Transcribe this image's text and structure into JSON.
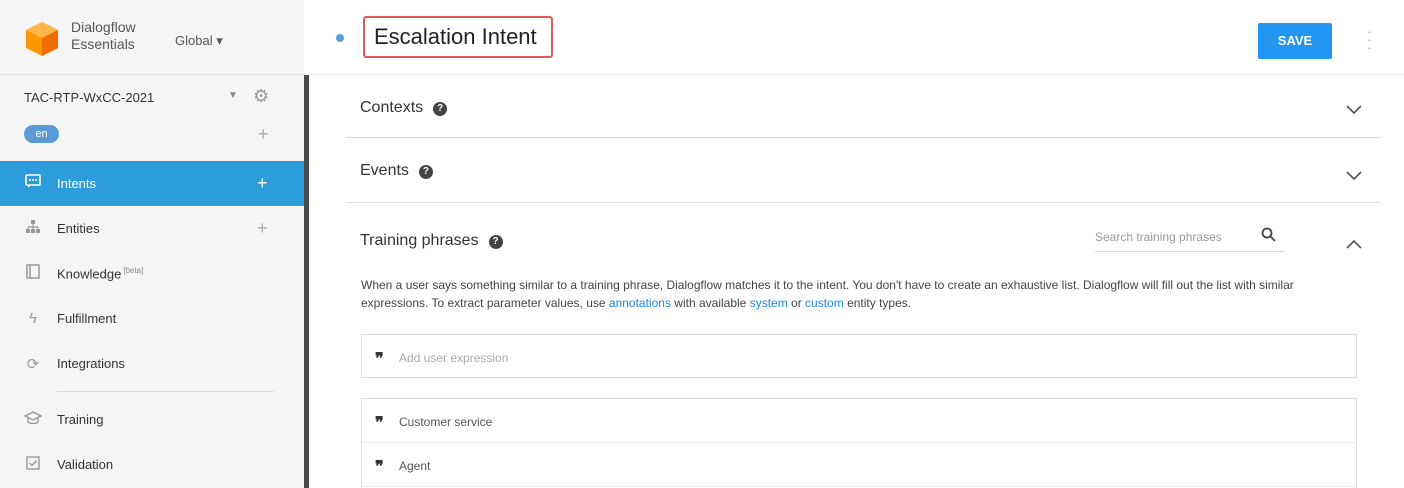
{
  "sidebar": {
    "brand_line1": "Dialogflow",
    "brand_line2": "Essentials",
    "region": "Global",
    "agent_name": "TAC-RTP-WxCC-2021",
    "language": "en",
    "nav": [
      {
        "label": "Intents",
        "icon": "chat-icon",
        "active": true
      },
      {
        "label": "Entities",
        "icon": "hierarchy-icon"
      },
      {
        "label": "Knowledge",
        "beta": "[beta]",
        "icon": "book-icon"
      },
      {
        "label": "Fulfillment",
        "icon": "bolt-icon"
      },
      {
        "label": "Integrations",
        "icon": "sync-icon"
      },
      {
        "label": "Training",
        "icon": "graduation-cap-icon"
      },
      {
        "label": "Validation",
        "icon": "checkbox-icon"
      }
    ]
  },
  "header": {
    "intent_name": "Escalation Intent",
    "save_label": "SAVE"
  },
  "sections": {
    "contexts": "Contexts",
    "events": "Events",
    "training": "Training phrases"
  },
  "training": {
    "search_placeholder": "Search training phrases",
    "desc_1": "When a user says something similar to a training phrase, Dialogflow matches it to the intent. You don't have to create an exhaustive list. Dialogflow will fill out the list with similar expressions. To extract parameter values, use ",
    "link_annotations": "annotations",
    "desc_2": " with available ",
    "link_system": "system",
    "desc_3": " or ",
    "link_custom": "custom",
    "desc_4": " entity types.",
    "add_placeholder": "Add user expression",
    "phrases": [
      "Customer service",
      "Agent"
    ]
  },
  "colors": {
    "accent": "#2196f3",
    "active_nav": "#2d9cdb",
    "highlight_border": "#e05a5a"
  }
}
